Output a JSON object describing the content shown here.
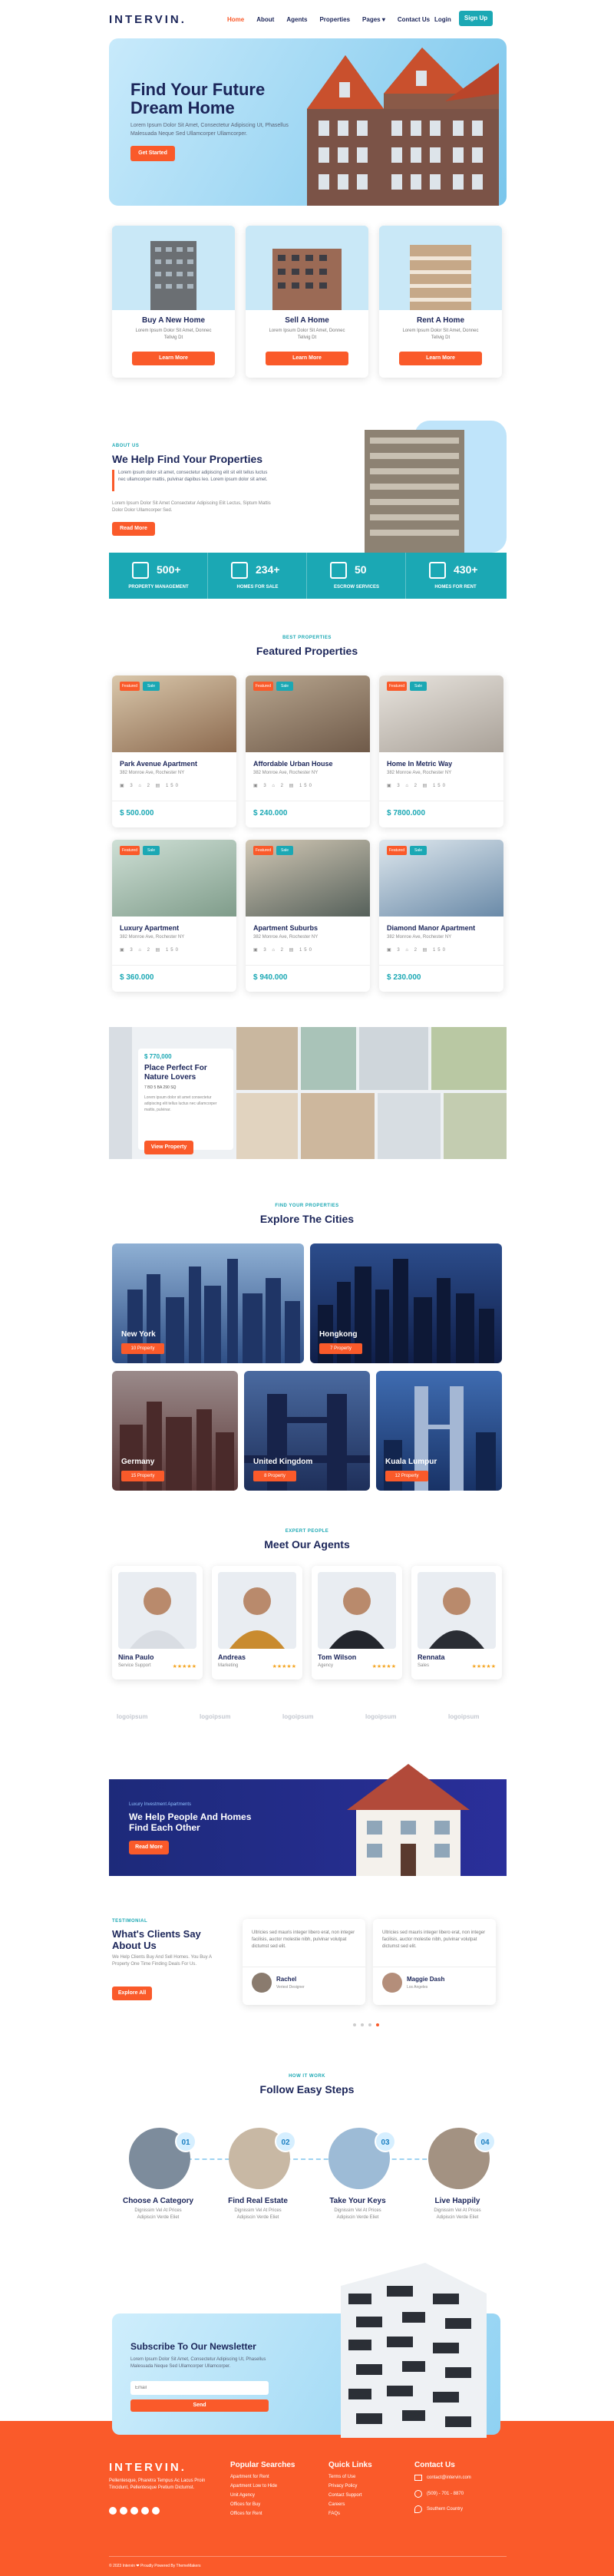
{
  "nav": {
    "logo": "INTERVIN.",
    "items": [
      "Home",
      "About",
      "Agents",
      "Properties",
      "Pages ▾",
      "Contact Us"
    ],
    "login": "Login",
    "signup": "Sign Up"
  },
  "hero": {
    "title": "Find Your Future Dream Home",
    "text": "Lorem Ipsum Dolor Sit Amet, Consectetur Adipiscing Ut, Phasellus Malesuada Neque Sed Ullamcorper Ullamcorper.",
    "button": "Get Started"
  },
  "services": [
    {
      "title": "Buy A New Home",
      "text": "Lorem Ipsum Dolor Sit Amet, Donnec Tellvig Dt",
      "button": "Learn More"
    },
    {
      "title": "Sell A Home",
      "text": "Lorem Ipsum Dolor Sit Amet, Donnec Tellvig Dt",
      "button": "Learn More"
    },
    {
      "title": "Rent A Home",
      "text": "Lorem Ipsum Dolor Sit Amet, Donnec Tellvig Dt",
      "button": "Learn More"
    }
  ],
  "about": {
    "tag": "ABOUT US",
    "title": "We Help Find Your Properties",
    "quote": "Lorem ipsum dolor sit amet, consectetur adipiscing elit sit elit tellus luctus nec ullamcorper mattis, pulvinar dapibus leo. Lorem ipsum dolor sit amet.",
    "text": "Lorem Ipsum Dolor Sit Amet Consectetur Adipiscing Elit Lectus, Siptum Mattis Dolor Dolor Ullamcorper Sed.",
    "button": "Read More"
  },
  "stats": [
    {
      "num": "500+",
      "label": "PROPERTY MANAGEMENT"
    },
    {
      "num": "234+",
      "label": "HOMES FOR SALE"
    },
    {
      "num": "50",
      "label": "ESCROW SERVICES"
    },
    {
      "num": "430+",
      "label": "HOMES FOR RENT"
    }
  ],
  "featured": {
    "tag": "BEST PROPERTIES",
    "title": "Featured Properties",
    "items": [
      {
        "name": "Park Avenue Apartment",
        "addr": "382 Monroe Ave, Rochester NY",
        "price": "$ 500.000",
        "t1": "Featured",
        "t2": "Sale"
      },
      {
        "name": "Affordable Urban House",
        "addr": "382 Monroe Ave, Rochester NY",
        "price": "$ 240.000",
        "t1": "Featured",
        "t2": "Sale"
      },
      {
        "name": "Home In Metric Way",
        "addr": "382 Monroe Ave, Rochester NY",
        "price": "$ 7800.000",
        "t1": "Featured",
        "t2": "Sale"
      },
      {
        "name": "Luxury Apartment",
        "addr": "382 Monroe Ave, Rochester NY",
        "price": "$ 360.000",
        "t1": "Featured",
        "t2": "Sale"
      },
      {
        "name": "Apartment Suburbs",
        "addr": "382 Monroe Ave, Rochester NY",
        "price": "$ 940.000",
        "t1": "Featured",
        "t2": "Sale"
      },
      {
        "name": "Diamond Manor Apartment",
        "addr": "382 Monroe Ave, Rochester NY",
        "price": "$ 230.000",
        "t1": "Featured",
        "t2": "Sale"
      }
    ],
    "features": "▣ 3  ⌂ 2  ▤ 150"
  },
  "promo": {
    "price": "$ 770,000",
    "title": "Place Perfect For Nature Lovers",
    "meta": "7 BD    5 BA    290 SQ",
    "text": "Lorem ipsum dolor sit amet consectetur adipiscing elit tellus luctus nec ullamcorper mattis, pulvinar.",
    "button": "View Property"
  },
  "cities": {
    "tag": "FIND YOUR PROPERTIES",
    "title": "Explore The Cities",
    "items": [
      {
        "name": "New York",
        "count": "10 Property"
      },
      {
        "name": "Hongkong",
        "count": "7 Property"
      },
      {
        "name": "Germany",
        "count": "15 Property"
      },
      {
        "name": "United Kingdom",
        "count": "8 Property"
      },
      {
        "name": "Kuala Lumpur",
        "count": "12 Property"
      }
    ]
  },
  "agents": {
    "tag": "EXPERT PEOPLE",
    "title": "Meet Our Agents",
    "items": [
      {
        "name": "Nina Paulo",
        "role": "Service Support",
        "stars": "★★★★★"
      },
      {
        "name": "Andreas",
        "role": "Marketing",
        "stars": "★★★★★"
      },
      {
        "name": "Tom Wilson",
        "role": "Agency",
        "stars": "★★★★★"
      },
      {
        "name": "Rennata",
        "role": "Sales",
        "stars": "★★★★★"
      }
    ],
    "partners": [
      "logoipsum",
      "logoipsum",
      "logoipsum",
      "logoipsum",
      "logoipsum"
    ]
  },
  "cta": {
    "tag": "Luxury Investment Apartments",
    "title": "We Help People And Homes Find Each Other",
    "button": "Read More"
  },
  "testimonials": {
    "tag": "TESTIMONIAL",
    "title": "What's Clients Say About Us",
    "text": "We Help Clients Buy And Sell Homes. You Buy A Property One Time Finding Deals For Us.",
    "button": "Explore All",
    "items": [
      {
        "quote": "Ultricies sed mauris integer libero erat, non integer facilisis, auctor molestie nibh, pulvinar volutpat dictumst sed elit.",
        "name": "Rachel",
        "role": "Veriest Designer"
      },
      {
        "quote": "Ultricies sed mauris integer libero erat, non integer facilisis, auctor molestie nibh, pulvinar volutpat dictumst sed elit.",
        "name": "Maggie Dash",
        "role": "Los Angeles"
      }
    ]
  },
  "steps": {
    "tag": "HOW IT WORK",
    "title": "Follow Easy Steps",
    "items": [
      {
        "num": "01",
        "name": "Choose A Category",
        "desc": "Dignissim Vel At Prices Adipiscin Verde Eliet"
      },
      {
        "num": "02",
        "name": "Find Real Estate",
        "desc": "Dignissim Vel At Prices Adipiscin Verde Eliet"
      },
      {
        "num": "03",
        "name": "Take Your Keys",
        "desc": "Dignissim Vel At Prices Adipiscin Verde Eliet"
      },
      {
        "num": "04",
        "name": "Live Happily",
        "desc": "Dignissim Vel At Prices Adipiscin Verde Eliet"
      }
    ]
  },
  "newsletter": {
    "title": "Subscribe To Our Newsletter",
    "text": "Lorem Ipsum Dolor Sit Amet, Consectetur Adipiscing Ut, Phasellus Malesuada Neque Sed Ullamcorper Ullamcorper.",
    "placeholder": "Email",
    "button": "Send"
  },
  "footer": {
    "logo": "INTERVIN.",
    "about": "Pellentesque, Pharetra Tempus Ac Lacus Proin Tincidunt, Pellentesque Pretium Dictumst.",
    "popular_title": "Popular Searches",
    "popular": [
      "Apartment for Rent",
      "Apartment Low to Hide",
      "Unit Agency",
      "Offices for Buy",
      "Offices for Rent"
    ],
    "quick_title": "Quick Links",
    "quick": [
      "Terms of Use",
      "Privacy Policy",
      "Contact Support",
      "Careers",
      "FAQs"
    ],
    "contact_title": "Contact Us",
    "contact": [
      "contact@intervin.com",
      "(509) - 701 - 8870",
      "Southern Country"
    ],
    "copyright": "© 2023 Intervin ❤ Proudly Powered By ThemeMakers"
  },
  "colors": {
    "accent": "#fa5a2a",
    "teal": "#1ba8b4",
    "navy": "#1b2559"
  }
}
